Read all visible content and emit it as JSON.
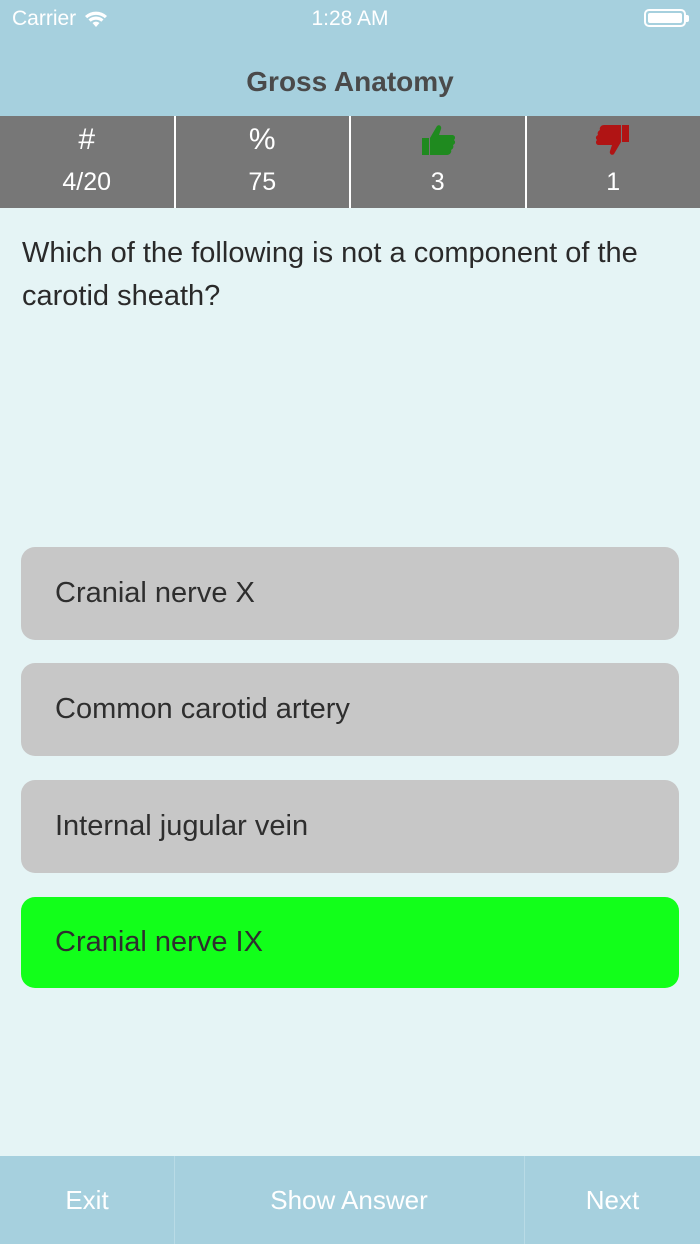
{
  "status_bar": {
    "carrier": "Carrier",
    "time": "1:28 AM"
  },
  "nav": {
    "title": "Gross Anatomy"
  },
  "stats": [
    {
      "header": "#",
      "value": "4/20"
    },
    {
      "header": "%",
      "value": "75"
    },
    {
      "header_icon": "thumbs-up-icon",
      "value": "3",
      "icon_color": "#1f8a1f"
    },
    {
      "header_icon": "thumbs-down-icon",
      "value": "1",
      "icon_color": "#b01414"
    }
  ],
  "question": {
    "text": "Which of the following is not a component of the carotid sheath?"
  },
  "answers": [
    {
      "label": "Cranial nerve X",
      "state": "default"
    },
    {
      "label": "Common carotid artery",
      "state": "default"
    },
    {
      "label": "Internal jugular vein",
      "state": "default"
    },
    {
      "label": "Cranial nerve IX",
      "state": "correct"
    }
  ],
  "toolbar": {
    "exit_label": "Exit",
    "show_answer_label": "Show Answer",
    "next_label": "Next"
  },
  "colors": {
    "bar": "#a6d0de",
    "background": "#e5f4f5",
    "stats_bg": "#777777",
    "answer_default": "#c7c7c7",
    "answer_correct": "#12ff1a"
  }
}
